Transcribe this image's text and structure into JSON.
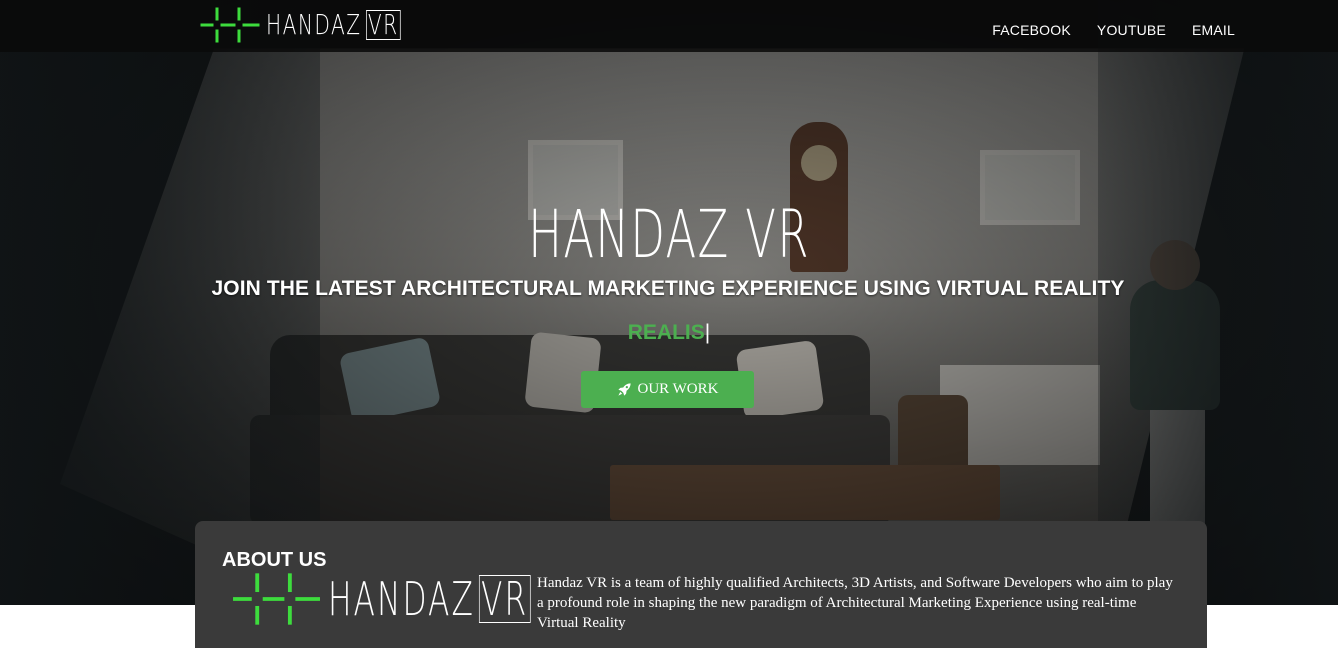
{
  "brand": {
    "logo_icon": "grid-crosshair-logo",
    "name": "HANDAZ",
    "suffix": "VR",
    "accent_color": "#3ddc3d"
  },
  "nav": {
    "links": [
      "FACEBOOK",
      "YOUTUBE",
      "EMAIL"
    ]
  },
  "hero": {
    "title": "HANDAZ VR",
    "subtitle": "JOIN THE LATEST ARCHITECTURAL MARKETING EXPERIENCE USING VIRTUAL REALITY",
    "typed_text": "REALIS",
    "typed_color": "#4caf50",
    "cta_icon": "rocket-icon",
    "cta_label": "OUR WORK",
    "cta_color": "#4caf50"
  },
  "about": {
    "heading": "ABOUT US",
    "logo_name": "HANDAZ",
    "logo_suffix": "VR",
    "text": "Handaz VR is a team of highly qualified Architects, 3D Artists, and Software Developers who aim to play a profound role in shaping the new paradigm of Architectural Marketing Experience using real-time Virtual Reality"
  }
}
